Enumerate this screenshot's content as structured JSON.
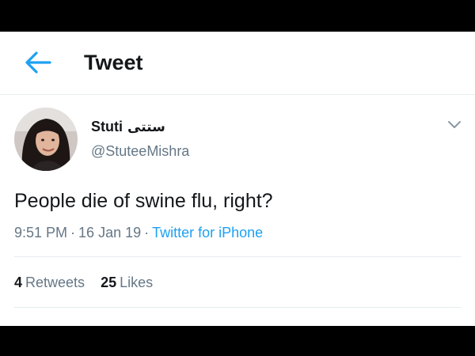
{
  "header": {
    "title": "Tweet",
    "back_icon": "arrow-left-icon",
    "accent": "#1da1f2"
  },
  "tweet": {
    "author_name": "Stuti",
    "author_name_alt": "ستتی",
    "handle": "@StuteeMishra",
    "text": "People die of swine flu, right?",
    "time": "9:51 PM",
    "date": "16 Jan 19",
    "separator": "·",
    "source": "Twitter for iPhone",
    "menu_icon": "chevron-down-icon"
  },
  "stats": {
    "retweets_count": "4",
    "retweets_label": "Retweets",
    "likes_count": "25",
    "likes_label": "Likes"
  }
}
